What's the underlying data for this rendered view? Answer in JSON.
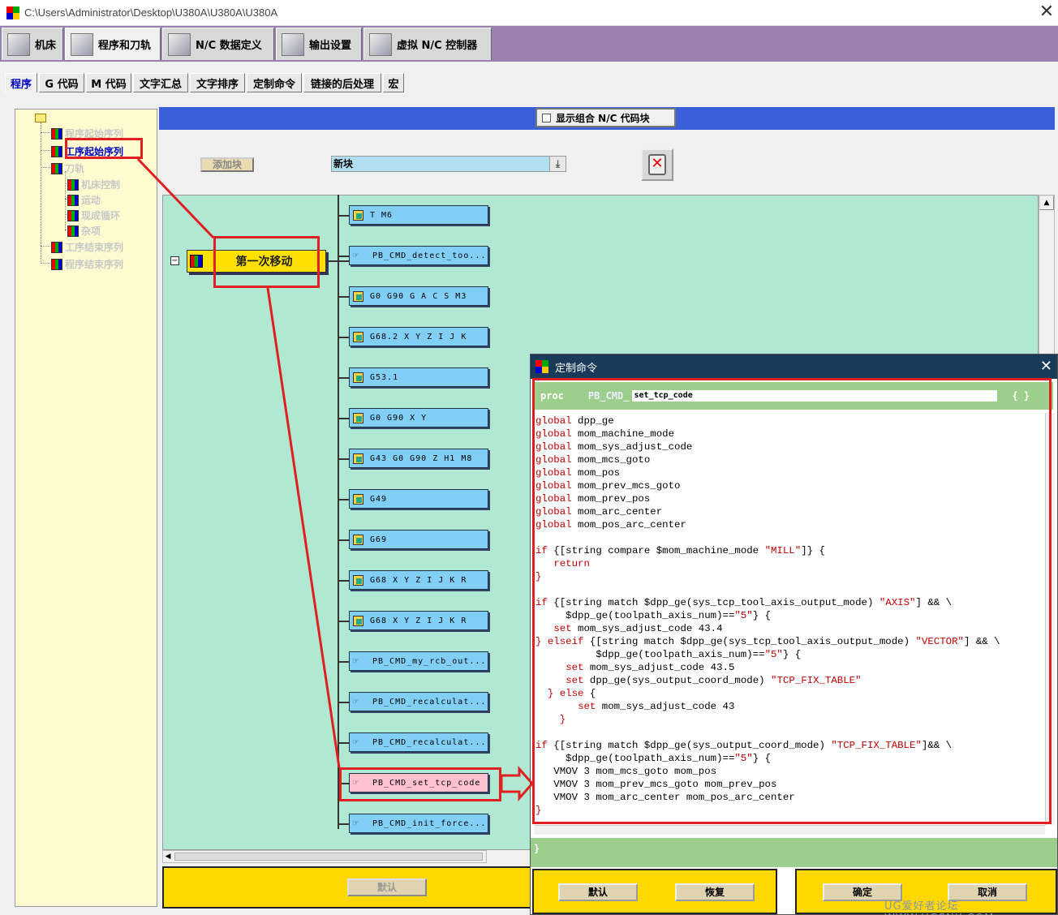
{
  "window": {
    "title": "C:\\Users\\Administrator\\Desktop\\U380A\\U380A\\U380A"
  },
  "main_tabs": [
    "机床",
    "程序和刀轨",
    "N/C 数据定义",
    "输出设置",
    "虚拟 N/C 控制器"
  ],
  "sub_tabs": [
    "程序",
    "G 代码",
    "M 代码",
    "文字汇总",
    "文字排序",
    "定制命令",
    "链接的后处理",
    "宏"
  ],
  "tree": {
    "items": [
      "程序起始序列",
      "工序起始序列",
      "刀轨",
      "机床控制",
      "运动",
      "现成循环",
      "杂项",
      "工序结束序列",
      "程序结束序列"
    ]
  },
  "toolbar": {
    "combo_checkbox_label": "显示组合 N/C 代码块",
    "add_block_label": "添加块",
    "new_block_value": "新块"
  },
  "event": {
    "label": "第一次移动"
  },
  "blocks": [
    "T M6",
    "PB_CMD_detect_too...",
    "G0 G90 G A C S M3",
    "G68.2 X Y Z I J K",
    "G53.1",
    "G0 G90 X Y",
    "G43 G0 G90 Z H1 M8",
    "G49",
    "G69",
    "G68 X Y Z I J K R",
    "G68 X Y Z I J K R",
    "PB_CMD_my_rcb_out...",
    "PB_CMD_recalculat...",
    "PB_CMD_recalculat...",
    "PB_CMD_set_tcp_code",
    "PB_CMD_init_force..."
  ],
  "footer": {
    "default_label": "默认"
  },
  "dialog": {
    "title": "定制命令",
    "proc_keyword": "proc",
    "proc_prefix": "PB_CMD_",
    "proc_name": "set_tcp_code",
    "proc_braces": "{ }",
    "end_brace": "}",
    "default_label": "默认",
    "restore_label": "恢复",
    "ok_label": "确定",
    "cancel_label": "取消"
  },
  "code_lines": [
    "global dpp_ge",
    "global mom_machine_mode",
    "global mom_sys_adjust_code",
    "global mom_mcs_goto",
    "global mom_pos",
    "global mom_prev_mcs_goto",
    "global mom_prev_pos",
    "global mom_arc_center",
    "global mom_pos_arc_center",
    "",
    "if {[string compare $mom_machine_mode \"MILL\"]} {",
    "   return",
    "}",
    "",
    "if {[string match $dpp_ge(sys_tcp_tool_axis_output_mode) \"AXIS\"] && \\",
    "     $dpp_ge(toolpath_axis_num)==\"5\"} {",
    "   set mom_sys_adjust_code 43.4",
    "} elseif {[string match $dpp_ge(sys_tcp_tool_axis_output_mode) \"VECTOR\"] && \\",
    "          $dpp_ge(toolpath_axis_num)==\"5\"} {",
    "     set mom_sys_adjust_code 43.5",
    "     set dpp_ge(sys_output_coord_mode) \"TCP_FIX_TABLE\"",
    "  } else {",
    "       set mom_sys_adjust_code 43",
    "    }",
    "",
    "if {[string match $dpp_ge(sys_output_coord_mode) \"TCP_FIX_TABLE\"]&& \\",
    "     $dpp_ge(toolpath_axis_num)==\"5\"} {",
    "   VMOV 3 mom_mcs_goto mom_pos",
    "   VMOV 3 mom_prev_mcs_goto mom_prev_pos",
    "   VMOV 3 mom_arc_center mom_pos_arc_center",
    "}"
  ],
  "watermark": "UG爱好者论坛 WWW.UGSNX.COM",
  "colors": {
    "annotation": "#e02020",
    "accent_blue": "#3a5fd8",
    "canvas": "#b0e8d4",
    "footer_yellow": "#ffd800"
  }
}
